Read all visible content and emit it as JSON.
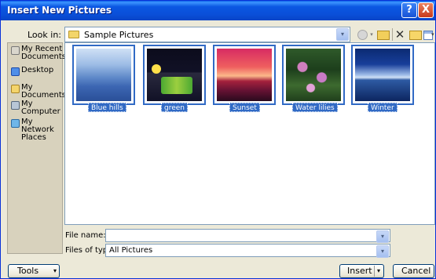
{
  "window": {
    "title": "Insert New Pictures",
    "help_glyph": "?",
    "close_glyph": "X"
  },
  "lookin": {
    "label": "Look in:",
    "value": "Sample Pictures",
    "dropdown_glyph": "▾"
  },
  "toolbar": {
    "delete_glyph": "✕",
    "dropdown_glyph": "▾"
  },
  "places": [
    {
      "label": "My Recent Documents",
      "icon": "recent-documents-icon"
    },
    {
      "label": "Desktop",
      "icon": "desktop-icon"
    },
    {
      "label": "My Documents",
      "icon": "my-documents-icon"
    },
    {
      "label": "My Computer",
      "icon": "my-computer-icon"
    },
    {
      "label": "My Network Places",
      "icon": "network-places-icon"
    }
  ],
  "files": [
    {
      "name": "Blue hills"
    },
    {
      "name": "green"
    },
    {
      "name": "Sunset"
    },
    {
      "name": "Water lilies"
    },
    {
      "name": "Winter"
    }
  ],
  "file_name": {
    "label": "File name:",
    "value": ""
  },
  "file_type": {
    "label": "Files of type:",
    "value": "All Pictures"
  },
  "buttons": {
    "tools": "Tools",
    "insert": "Insert",
    "cancel": "Cancel",
    "dropdown_glyph": "▾"
  }
}
